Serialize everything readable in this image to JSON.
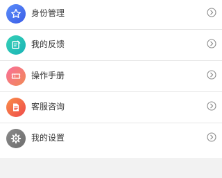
{
  "menu": {
    "items": [
      {
        "label": "身份管理",
        "icon": "star-icon",
        "colors": [
          "#5a8dfa",
          "#3b5de6"
        ]
      },
      {
        "label": "我的反馈",
        "icon": "edit-note-icon",
        "colors": [
          "#35d0b6",
          "#1ab3b7"
        ]
      },
      {
        "label": "操作手册",
        "icon": "ticket-icon",
        "colors": [
          "#f96f9a",
          "#f08a55"
        ]
      },
      {
        "label": "客服咨询",
        "icon": "document-icon",
        "colors": [
          "#f98e4a",
          "#ef4a4a"
        ]
      },
      {
        "label": "我的设置",
        "icon": "gear-icon",
        "colors": [
          "#8a8a8a",
          "#6e6e6e"
        ]
      }
    ],
    "chevron_icon": "chevron-right-circle-icon",
    "chevron_color": "#8a8a8a"
  }
}
